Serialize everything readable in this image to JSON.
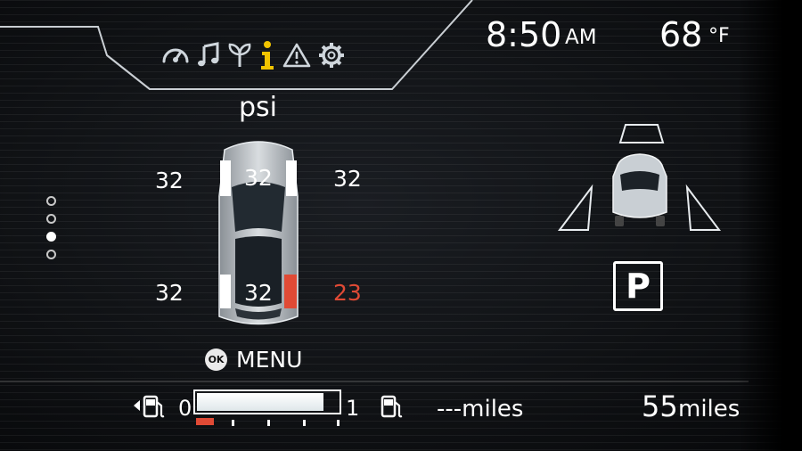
{
  "clock": {
    "time": "8:50",
    "ampm": "AM"
  },
  "temperature": {
    "value": "68",
    "unit": "°F"
  },
  "menu_icons": [
    "gauge-icon",
    "music-note-icon",
    "eco-leaf-icon",
    "info-icon",
    "warning-icon",
    "settings-gear-icon"
  ],
  "active_menu_icon": "info-icon",
  "tire_pressure": {
    "unit": "psi",
    "front_left": "32",
    "front_right": "32",
    "rear_left": "32",
    "rear_right": "23",
    "front_center": "32",
    "rear_center": "32",
    "low_tire": "rear_right"
  },
  "colors": {
    "warning": "#e04a35",
    "active_icon": "#f2c400",
    "text": "#ffffff"
  },
  "page_indicator": {
    "total": 4,
    "active_index": 2
  },
  "menu": {
    "ok_label": "OK",
    "label": "MENU"
  },
  "gear": {
    "label": "P"
  },
  "fuel": {
    "empty_label": "0",
    "full_label": "1",
    "level": 0.9
  },
  "range": {
    "trip_text": "---miles",
    "value": "55",
    "unit": "miles"
  }
}
